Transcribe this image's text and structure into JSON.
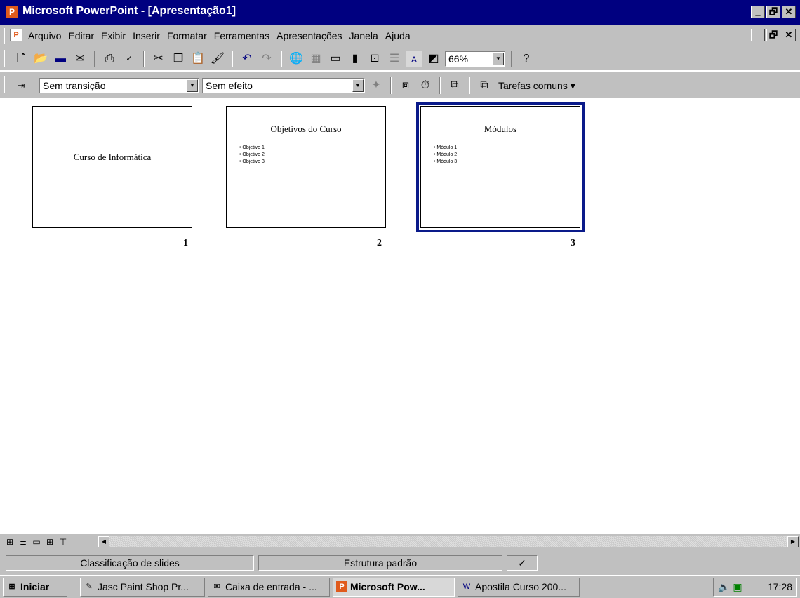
{
  "window": {
    "title": "Microsoft PowerPoint - [Apresentação1]",
    "controls": [
      "_",
      "🗗",
      "✕"
    ]
  },
  "menu": {
    "items": [
      "Arquivo",
      "Editar",
      "Exibir",
      "Inserir",
      "Formatar",
      "Ferramentas",
      "Apresentações",
      "Janela",
      "Ajuda"
    ]
  },
  "toolbar": {
    "zoom_value": "66%"
  },
  "formatting": {
    "transition_value": "Sem transição",
    "effect_value": "Sem efeito",
    "tarefas_label": "Tarefas comuns ▾"
  },
  "slides": [
    {
      "number": "1",
      "title": "Curso de Informática",
      "bullets": []
    },
    {
      "number": "2",
      "title": "Objetivos do Curso",
      "bullets": [
        "• Objetivo 1",
        "• Objetivo 2",
        "• Objetivo 3"
      ]
    },
    {
      "number": "3",
      "title": "Módulos",
      "bullets": [
        "• Módulo 1",
        "• Módulo 2",
        "• Módulo 3"
      ],
      "selected": true
    }
  ],
  "status": {
    "view": "Classificação de slides",
    "design": "Estrutura padrão"
  },
  "taskbar": {
    "start_label": "Iniciar",
    "tasks": [
      "Jasc Paint Shop Pr...",
      "Caixa de entrada - ...",
      "Microsoft Pow...",
      "Apostila Curso 200..."
    ],
    "clock": "17:28"
  },
  "colors": {
    "titlebar": "#000080",
    "selection": "#0a1a8a",
    "chrome": "#c0c0c0"
  }
}
